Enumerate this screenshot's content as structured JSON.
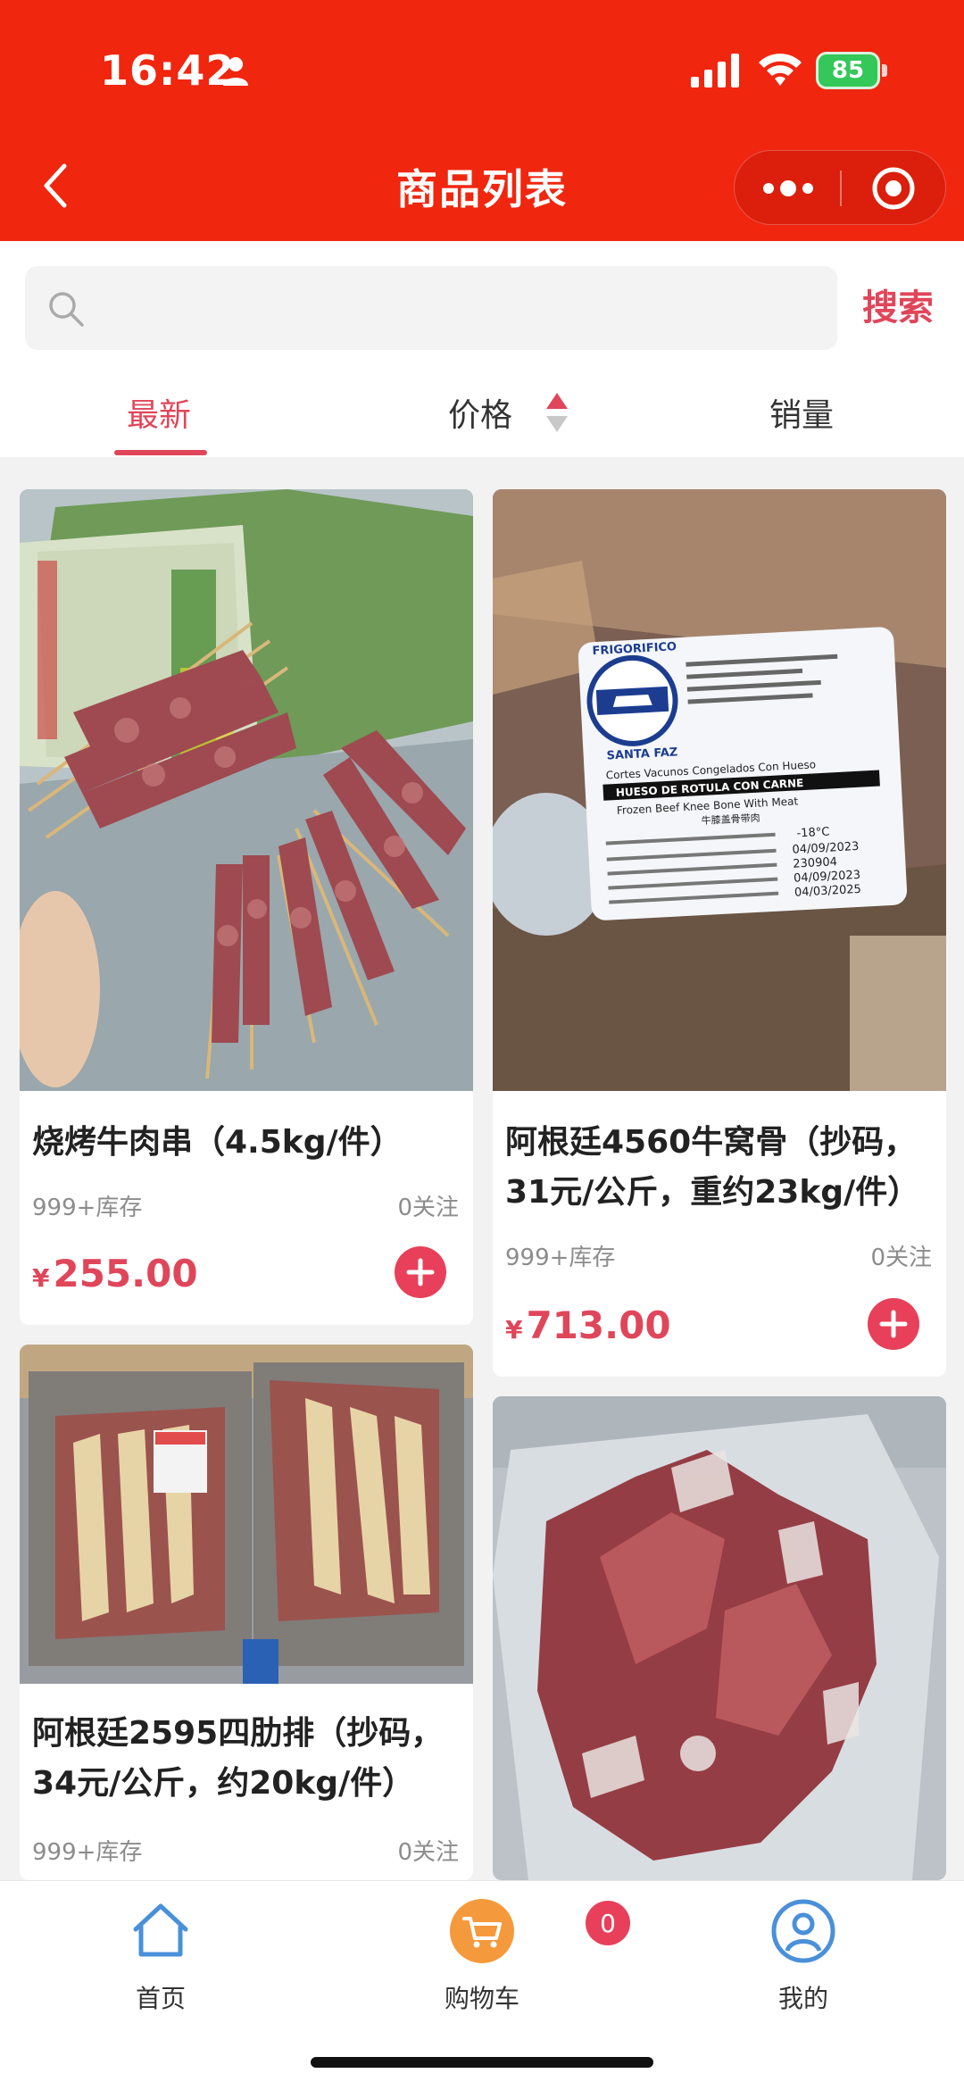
{
  "status_bar": {
    "time": "16:42",
    "battery": "85"
  },
  "header": {
    "title": "商品列表"
  },
  "search": {
    "placeholder": "",
    "button_label": "搜索"
  },
  "tabs": [
    {
      "label": "最新",
      "active": true
    },
    {
      "label": "价格",
      "active": false
    },
    {
      "label": "销量",
      "active": false
    }
  ],
  "products": [
    {
      "title": "烧烤牛肉串（4.5kg/件）",
      "stock": "999+库存",
      "follows": "0关注",
      "currency": "¥",
      "price": "255.00"
    },
    {
      "title": "阿根廷4560牛窝骨（抄码，31元/公斤，重约23kg/件）",
      "stock": "999+库存",
      "follows": "0关注",
      "currency": "¥",
      "price": "713.00",
      "label_text": {
        "brand": "FRIGORIFICO",
        "brand_sub": "SANTA FAZ",
        "line1": "Cortes Vacunos Congelados Con Hueso",
        "line2": "HUESO DE ROTULA CON CARNE",
        "line3": "Frozen Beef Knee Bone With Meat",
        "line4": "牛膝盖骨带肉",
        "temp": "-18°C",
        "d1": "04/09/2023",
        "lot": "230904",
        "d2": "04/09/2023",
        "d3": "04/03/2025"
      }
    },
    {
      "title": "阿根廷2595四肋排（抄码，34元/公斤，约20kg/件）",
      "stock": "999+库存",
      "follows": "0关注"
    },
    {
      "title": ""
    }
  ],
  "bottom_nav": [
    {
      "label": "首页",
      "icon": "home-icon"
    },
    {
      "label": "购物车",
      "icon": "cart-icon",
      "badge": "0"
    },
    {
      "label": "我的",
      "icon": "user-icon"
    }
  ],
  "colors": {
    "header_red": "#f0260f",
    "accent": "#e0465a",
    "nav_blue": "#4a90d9",
    "cart_orange": "#f59a3c"
  }
}
